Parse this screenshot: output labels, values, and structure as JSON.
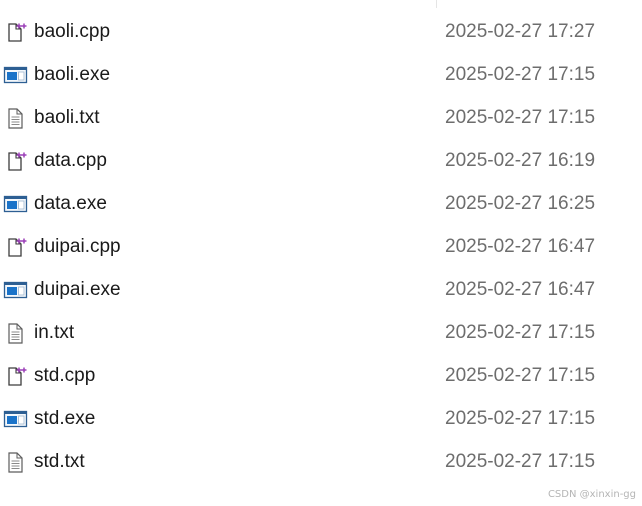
{
  "files": [
    {
      "name": "baoli.cpp",
      "modified": "2025-02-27 17:27",
      "icon": "cpp-file-icon"
    },
    {
      "name": "baoli.exe",
      "modified": "2025-02-27 17:15",
      "icon": "exe-file-icon"
    },
    {
      "name": "baoli.txt",
      "modified": "2025-02-27 17:15",
      "icon": "txt-file-icon"
    },
    {
      "name": "data.cpp",
      "modified": "2025-02-27 16:19",
      "icon": "cpp-file-icon"
    },
    {
      "name": "data.exe",
      "modified": "2025-02-27 16:25",
      "icon": "exe-file-icon"
    },
    {
      "name": "duipai.cpp",
      "modified": "2025-02-27 16:47",
      "icon": "cpp-file-icon"
    },
    {
      "name": "duipai.exe",
      "modified": "2025-02-27 16:47",
      "icon": "exe-file-icon"
    },
    {
      "name": "in.txt",
      "modified": "2025-02-27 17:15",
      "icon": "txt-file-icon"
    },
    {
      "name": "std.cpp",
      "modified": "2025-02-27 17:15",
      "icon": "cpp-file-icon"
    },
    {
      "name": "std.exe",
      "modified": "2025-02-27 17:15",
      "icon": "exe-file-icon"
    },
    {
      "name": "std.txt",
      "modified": "2025-02-27 17:15",
      "icon": "txt-file-icon"
    }
  ],
  "watermark": "CSDN @xinxin-gg",
  "colors": {
    "text": "#1a1a1a",
    "date_text": "#6d6d6d",
    "cpp_plus": "#9b3fb8",
    "exe_blue": "#1a73c9"
  }
}
